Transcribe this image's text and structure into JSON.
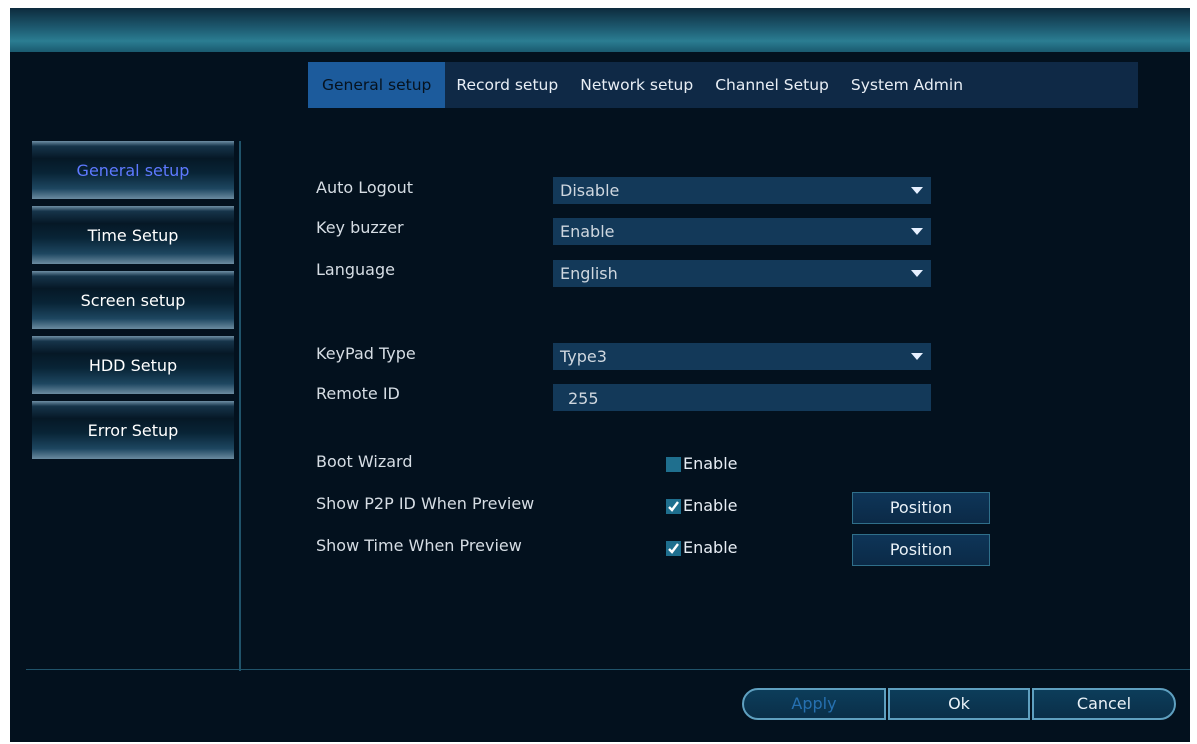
{
  "tabs": [
    {
      "label": "General setup",
      "active": true
    },
    {
      "label": "Record setup",
      "active": false
    },
    {
      "label": "Network setup",
      "active": false
    },
    {
      "label": "Channel Setup",
      "active": false
    },
    {
      "label": "System Admin",
      "active": false
    }
  ],
  "sidebar": {
    "items": [
      {
        "label": "General setup",
        "active": true
      },
      {
        "label": "Time Setup",
        "active": false
      },
      {
        "label": "Screen setup",
        "active": false
      },
      {
        "label": "HDD Setup",
        "active": false
      },
      {
        "label": "Error Setup",
        "active": false
      }
    ]
  },
  "form": {
    "auto_logout": {
      "label": "Auto Logout",
      "value": "Disable"
    },
    "key_buzzer": {
      "label": "Key buzzer",
      "value": "Enable"
    },
    "language": {
      "label": "Language",
      "value": "English"
    },
    "keypad_type": {
      "label": "KeyPad Type",
      "value": "Type3"
    },
    "remote_id": {
      "label": "Remote ID",
      "value": "255"
    },
    "boot_wizard": {
      "label": "Boot Wizard",
      "checkbox_label": "Enable",
      "checked": false
    },
    "show_p2p_id": {
      "label": "Show P2P ID When Preview",
      "checkbox_label": "Enable",
      "checked": true,
      "button_label": "Position"
    },
    "show_time": {
      "label": "Show Time When Preview",
      "checkbox_label": "Enable",
      "checked": true,
      "button_label": "Position"
    }
  },
  "footer": {
    "apply_label": "Apply",
    "ok_label": "Ok",
    "cancel_label": "Cancel"
  },
  "colors": {
    "background": "#03111e",
    "tab_bar": "#0f2946",
    "tab_active": "#1c5b9c",
    "field": "#133959",
    "sidebar_active_text": "#5e79ff",
    "checkbox": "#1f6f8e"
  }
}
